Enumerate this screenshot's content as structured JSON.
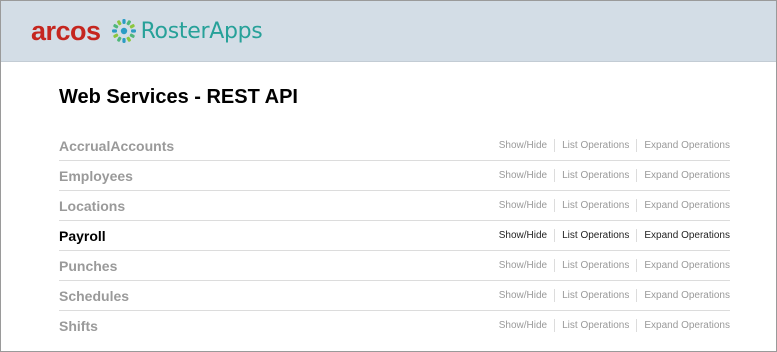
{
  "header": {
    "brand_primary": "arcos",
    "brand_secondary": "RosterApps",
    "brand_primary_color": "#c5261f",
    "brand_secondary_color": "#27a199",
    "icon": "sunburst-logo-icon"
  },
  "page": {
    "title": "Web Services - REST API"
  },
  "operations": {
    "show_hide": "Show/Hide",
    "list": "List Operations",
    "expand": "Expand Operations"
  },
  "resources": [
    {
      "name": "AccrualAccounts",
      "active": false
    },
    {
      "name": "Employees",
      "active": false
    },
    {
      "name": "Locations",
      "active": false
    },
    {
      "name": "Payroll",
      "active": true
    },
    {
      "name": "Punches",
      "active": false
    },
    {
      "name": "Schedules",
      "active": false
    },
    {
      "name": "Shifts",
      "active": false
    }
  ],
  "colors": {
    "header_bg": "#d3dde6",
    "inactive_text": "#9a9a9a",
    "active_text": "#000000"
  }
}
